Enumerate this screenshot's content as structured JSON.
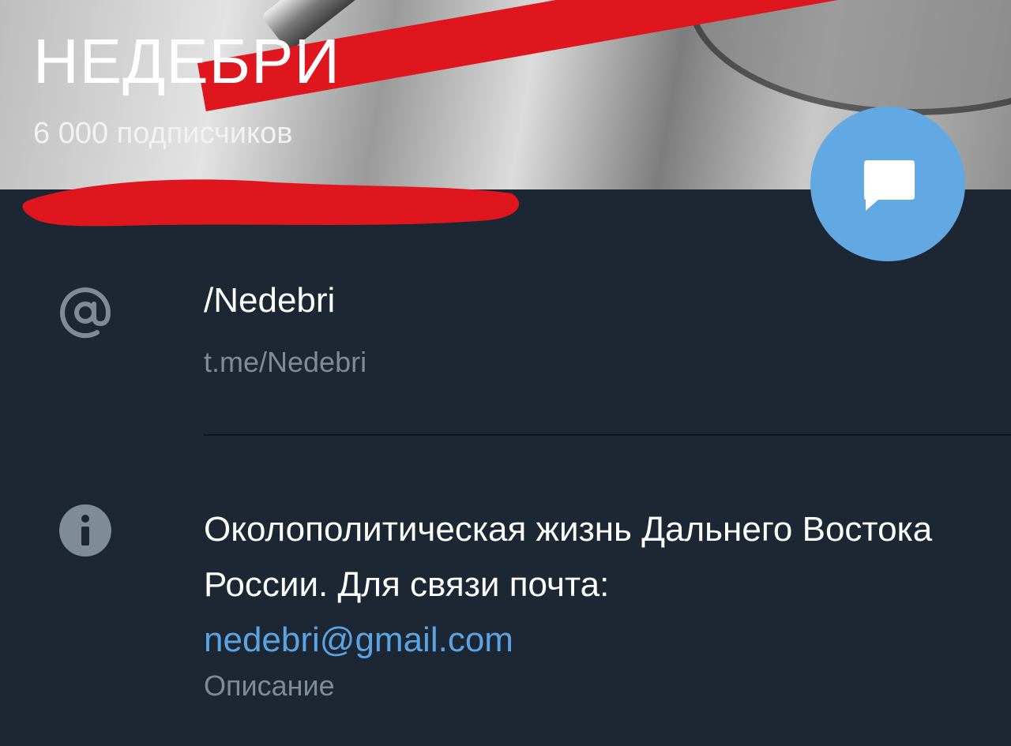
{
  "channel": {
    "name": "НЕДЕБРИ",
    "subscribers": "6 000 подписчиков"
  },
  "username": {
    "value": "/Nedebri",
    "link": "t.me/Nedebri",
    "icon": "at-icon"
  },
  "description": {
    "text": "Околополитическая жизнь Дальнего Востока России. Для связи почта:",
    "email": "nedebri@gmail.com",
    "label": "Описание",
    "icon": "info-icon"
  },
  "fab": {
    "icon": "message-icon"
  },
  "colors": {
    "background": "#1d2733",
    "accent": "#62a8e3",
    "secondary_text": "#7f8b96",
    "redaction": "#e0161e"
  }
}
